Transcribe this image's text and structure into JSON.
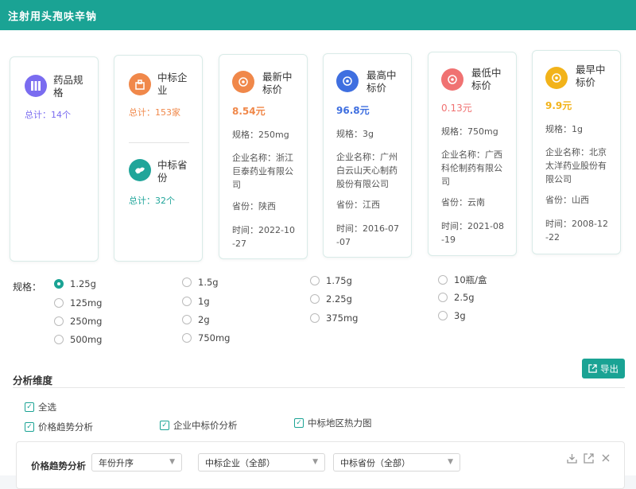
{
  "header": {
    "title": "注射用头孢呋辛钠"
  },
  "cards": {
    "spec": {
      "title_1": "药品规",
      "title_2": "格",
      "total": "总计：14个"
    },
    "company": {
      "title_1": "中标企",
      "title_2": "业",
      "total": "总计：153家"
    },
    "province": {
      "title_1": "中标省",
      "title_2": "份",
      "total": "总计：32个"
    },
    "newest": {
      "title_1": "最新中",
      "title_2": "标价",
      "value": "8.54元",
      "spec": "规格：250mg",
      "company_1": "企业名称：浙江",
      "company_2": "巨泰药业有限公",
      "company_3": "司",
      "province": "省份：陕西",
      "time_1": "时间：2022-10",
      "time_2": "-27"
    },
    "highest": {
      "title_1": "最高中",
      "title_2": "标价",
      "value": "96.8元",
      "spec": "规格：3g",
      "company_1": "企业名称：广州",
      "company_2": "白云山天心制药",
      "company_3": "股份有限公司",
      "province": "省份：江西",
      "time_1": "时间：2016-07",
      "time_2": "-07"
    },
    "lowest": {
      "title_1": "最低中",
      "title_2": "标价",
      "value": "0.13元",
      "spec": "规格：750mg",
      "company_1": "企业名称：广西",
      "company_2": "科伦制药有限公",
      "company_3": "司",
      "province": "省份：云南",
      "time_1": "时间：2021-08",
      "time_2": "-19"
    },
    "earliest": {
      "title_1": "最早中",
      "title_2": "标价",
      "value": "9.9元",
      "spec": "规格：1g",
      "company_1": "企业名称：北京",
      "company_2": "太洋药业股份有",
      "company_3": "限公司",
      "province": "省份：山西",
      "time_1": "时间：2008-12",
      "time_2": "-22"
    }
  },
  "specs": {
    "label": "规格：",
    "options": [
      "1.25g",
      "125mg",
      "250mg",
      "500mg",
      "1.5g",
      "1g",
      "2g",
      "750mg",
      "1.75g",
      "2.25g",
      "375mg",
      "10瓶/盒",
      "2.5g",
      "3g"
    ],
    "selected": "1.25g"
  },
  "analysis": {
    "title": "分析维度",
    "export_label": "导出",
    "select_all": "全选",
    "checks": [
      "价格趋势分析",
      "企业中标价分析",
      "中标地区热力图"
    ]
  },
  "panel": {
    "title": "价格趋势分析",
    "sort_select": "年份升序",
    "company_select": "中标企业（全部）",
    "province_select": "中标省份（全部）"
  },
  "colors": {
    "primary": "#1aa394",
    "purple": "#7a6cf0",
    "orange": "#f0884a",
    "blue": "#3f6fe0",
    "red": "#f07272",
    "yellow": "#f2b31a",
    "teal": "#20a59a"
  }
}
